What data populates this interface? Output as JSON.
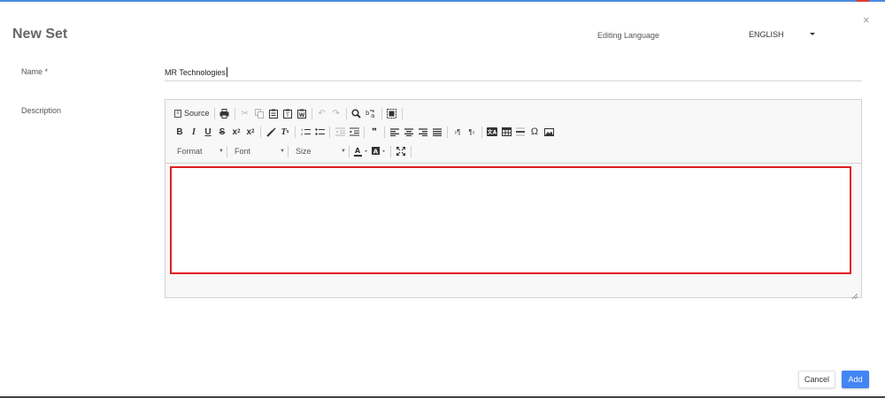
{
  "dialog": {
    "title": "New Set",
    "close_glyph": "×"
  },
  "language": {
    "label": "Editing Language",
    "selected": "ENGLISH"
  },
  "form": {
    "name_label": "Name *",
    "name_value": "MR Technologies",
    "description_label": "Description"
  },
  "editor": {
    "source_label": "Source",
    "format_label": "Format",
    "font_label": "Font",
    "size_label": "Size",
    "content": ""
  },
  "buttons": {
    "cancel": "Cancel",
    "add": "Add"
  },
  "colors": {
    "accent": "#4285f4",
    "top_bar": "#4a8be0",
    "highlight_border": "#e01e1e",
    "title": "#666666"
  },
  "icons": [
    "close-icon",
    "dropdown-caret-icon",
    "source-icon",
    "print-icon",
    "cut-icon",
    "copy-icon",
    "paste-icon",
    "paste-text-icon",
    "paste-word-icon",
    "undo-icon",
    "redo-icon",
    "find-icon",
    "replace-icon",
    "select-all-icon",
    "bold-icon",
    "italic-icon",
    "underline-icon",
    "strikethrough-icon",
    "subscript-icon",
    "superscript-icon",
    "copy-formatting-icon",
    "remove-format-icon",
    "numbered-list-icon",
    "bulleted-list-icon",
    "decrease-indent-icon",
    "increase-indent-icon",
    "blockquote-icon",
    "align-left-icon",
    "align-center-icon",
    "align-right-icon",
    "justify-icon",
    "text-direction-ltr-icon",
    "text-direction-rtl-icon",
    "language-icon",
    "table-icon",
    "horizontal-line-icon",
    "special-character-icon",
    "image-icon",
    "text-color-icon",
    "background-color-icon",
    "maximize-icon",
    "resize-icon"
  ]
}
